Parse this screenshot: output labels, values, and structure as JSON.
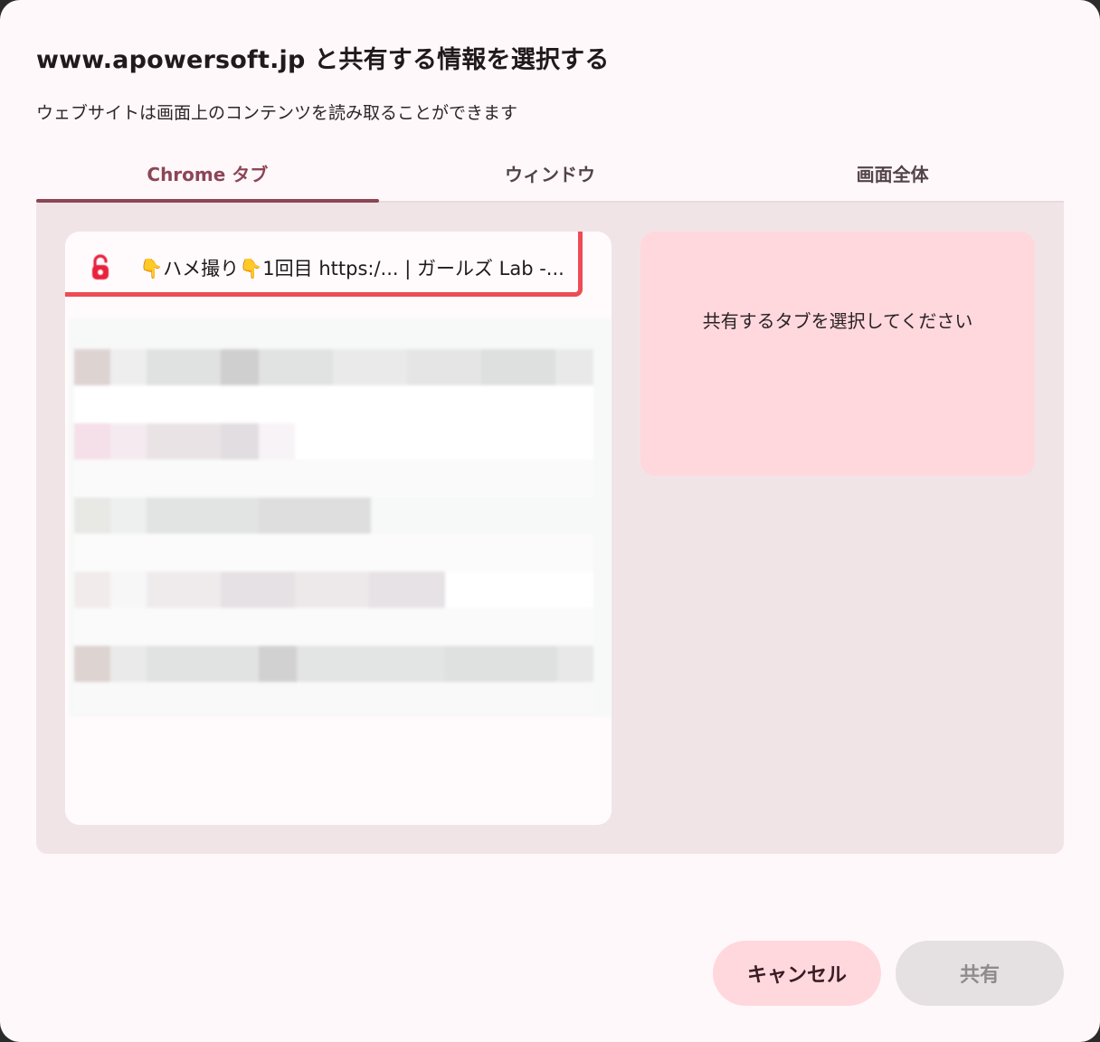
{
  "dialog": {
    "title": "www.apowersoft.jp と共有する情報を選択する",
    "subtitle": "ウェブサイトは画面上のコンテンツを読み取ることができます"
  },
  "tabs": [
    {
      "label": "Chrome タブ",
      "active": true
    },
    {
      "label": "ウィンドウ",
      "active": false
    },
    {
      "label": "画面全体",
      "active": false
    }
  ],
  "tab_list": [
    {
      "title": "👇ハメ撮り👇1回目 https:/... | ガールズ Lab -...",
      "favicon": "lock-icon"
    }
  ],
  "preview": {
    "placeholder": "共有するタブを選択してください"
  },
  "buttons": {
    "cancel": "キャンセル",
    "share": "共有"
  },
  "colors": {
    "accent": "#8b4656",
    "highlight_border": "#ee4c55",
    "cancel_bg": "#ffd8de",
    "share_disabled_bg": "#e5e1e2",
    "content_bg": "#f1e4e7"
  }
}
